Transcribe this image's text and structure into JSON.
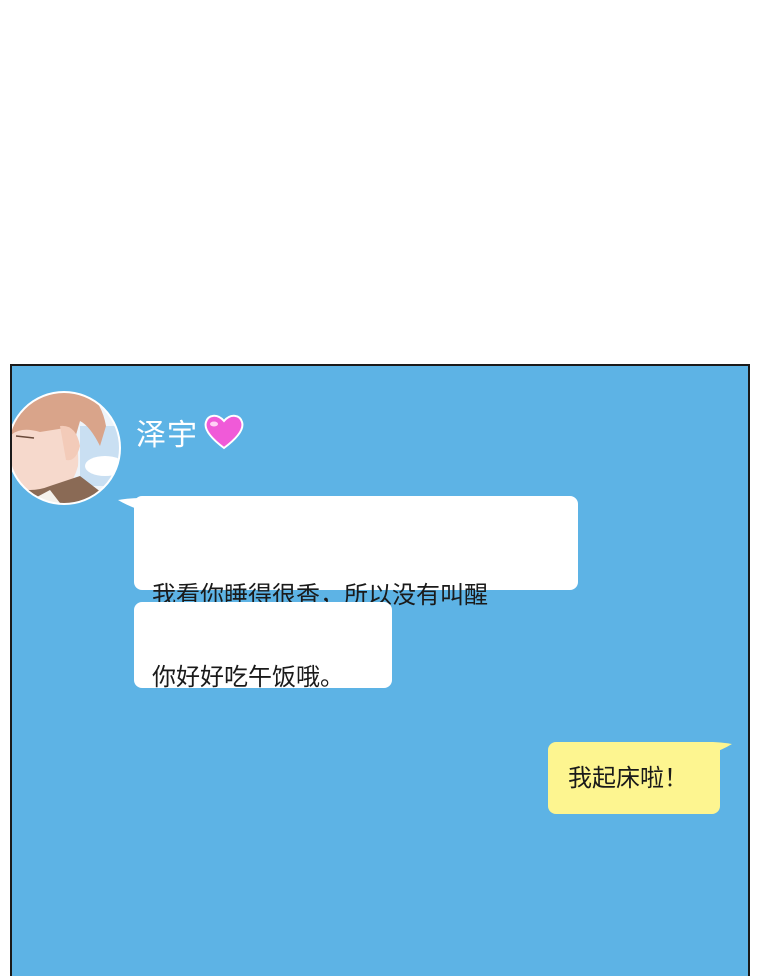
{
  "chat": {
    "contact_name": "泽宇",
    "heart_icon": "heart-icon",
    "colors": {
      "background": "#5db3e5",
      "incoming_bubble": "#ffffff",
      "outgoing_bubble": "#fdf590",
      "heart": "#f05ad8"
    },
    "messages": [
      {
        "sender": "contact",
        "text": "我看你睡得很香，所以没有叫醒\n你就出门了。"
      },
      {
        "sender": "contact",
        "text": "你好好吃午饭哦。"
      },
      {
        "sender": "me",
        "text": "我起床啦！"
      }
    ]
  }
}
